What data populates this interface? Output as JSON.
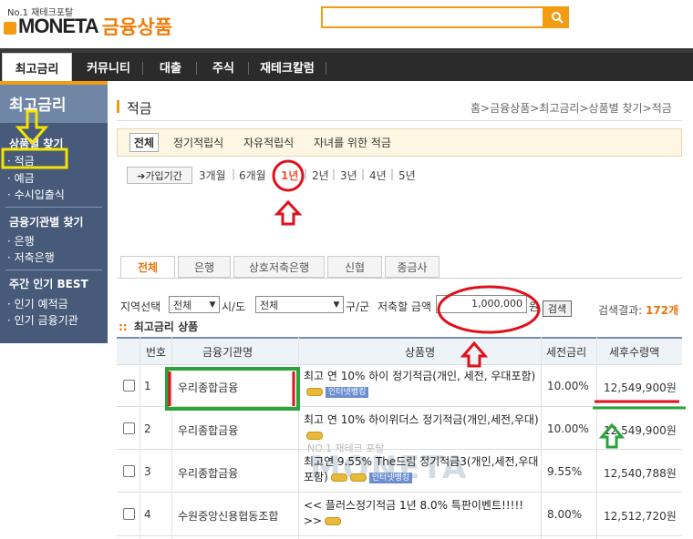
{
  "header": {
    "tagline": "No.1 재테크포탈",
    "logo_text": "MONETA",
    "logo_suffix": "금융상품",
    "search_value": "",
    "search_icon": "search-icon"
  },
  "gnb": [
    "최고금리",
    "커뮤니티",
    "대출",
    "주식",
    "재테크칼럼"
  ],
  "sidebar": {
    "title": "최고금리",
    "section1": "상품별 찾기",
    "items1": [
      "· 적금",
      "· 예금",
      "· 수시입출식"
    ],
    "section2": "금융기관별 찾기",
    "items2": [
      "· 은행",
      "· 저축은행"
    ],
    "section3": "주간 인기 BEST",
    "items3": [
      "· 인기 예적금",
      "· 인기 금융기관"
    ]
  },
  "page": {
    "title": "적금",
    "breadcrumb": "홈>금융상품>최고금리>상품별 찾기>적금"
  },
  "categories": [
    "전체",
    "정기적립식",
    "자유적립식",
    "자녀를 위한 적금"
  ],
  "period": {
    "button": "➔가입기간",
    "options": [
      "3개월",
      "6개월",
      "1년",
      "2년",
      "3년",
      "4년",
      "5년"
    ]
  },
  "tabs": [
    "전체",
    "은행",
    "상호저축은행",
    "신협",
    "종금사"
  ],
  "filters": {
    "region_label": "지역선택",
    "region_value": "전체",
    "city_label": "시/도",
    "city_value": "전체",
    "district_label": "구/군",
    "amount_label": "저축할 금액",
    "amount_value": "1,000,000",
    "amount_unit": "원",
    "search_button": "검색",
    "result_label": "검색결과:",
    "result_count": "172개"
  },
  "section_title": "최고금리 상품",
  "table": {
    "headers": [
      "번호",
      "금융기관명",
      "상품명",
      "세전금리",
      "세후수령액"
    ],
    "rows": [
      {
        "no": "1",
        "inst": "우리종합금융",
        "prod": "최고 연 10% 하이 정기적금(개인, 세전, 우대포함)",
        "rate": "10.00%",
        "amount": "12,549,900원"
      },
      {
        "no": "2",
        "inst": "우리종합금융",
        "prod": "최고 연 10% 하이위더스 정기적금(개인,세전,우대)",
        "rate": "10.00%",
        "amount": "12,549,900원"
      },
      {
        "no": "3",
        "inst": "우리종합금융",
        "prod": "최고연 9.55% The드림 정기적금3(개인,세전,우대포함)",
        "rate": "9.55%",
        "amount": "12,540,788원"
      },
      {
        "no": "4",
        "inst": "수원중앙신용협동조합",
        "prod": "<< 플러스정기적금 1년 8.0% 특판이벤트!!!!! >>",
        "rate": "8.00%",
        "amount": "12,512,720원"
      }
    ],
    "badge": "인터넷뱅킹",
    "watermark_small": "NO.1 재테크 포탈",
    "watermark_big": "MONETA"
  },
  "colors": {
    "accent": "#f39c12",
    "sidebar": "#475a79",
    "annotation_red": "#e0101a",
    "annotation_green": "#2aa43a",
    "annotation_yellow": "#f5e400"
  }
}
